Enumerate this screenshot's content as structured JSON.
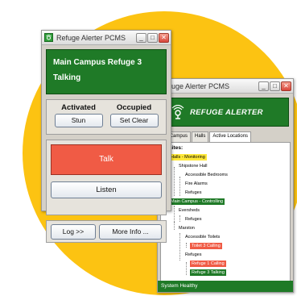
{
  "main_window": {
    "title": "Refuge Alerter PCMS",
    "status": {
      "line1": "Main Campus Refuge 3",
      "line2": "Talking"
    },
    "state": {
      "activated_label": "Activated",
      "stun_button": "Stun",
      "occupied_label": "Occupied",
      "set_clear_button": "Set Clear"
    },
    "talk_button": "Talk",
    "listen_button": "Listen",
    "log_button": "Log >>",
    "more_info_button": "More Info ..."
  },
  "alert_window": {
    "title": "Refuge Alerter PCMS",
    "banner_title": "REFUGE ALERTER",
    "tabs": [
      "ain Campus",
      "Halls",
      "Active Locations"
    ],
    "tree_header": "ll Sites:",
    "tree": [
      {
        "label": "Halls - Monitoring",
        "status": "monitoring"
      },
      {
        "label": "Shipstone Hall",
        "status": ""
      },
      {
        "label": "Accessible Bedrooms",
        "status": ""
      },
      {
        "label": "Fire Alarms",
        "status": ""
      },
      {
        "label": "Refuges",
        "status": ""
      },
      {
        "label": "Main Campus - Controlling",
        "status": "controlling"
      },
      {
        "label": "Eversheds",
        "status": ""
      },
      {
        "label": "Refuges",
        "status": ""
      },
      {
        "label": "Marston",
        "status": ""
      },
      {
        "label": "Accessible Toilets",
        "status": ""
      },
      {
        "label": "Toilet 3 Calling",
        "status": "calling"
      },
      {
        "label": "Refuges",
        "status": ""
      },
      {
        "label": "Refuge 1 Calling",
        "status": "calling"
      },
      {
        "label": "Refuge 3 Talking",
        "status": "talking"
      }
    ],
    "status_bar": "System Healthy"
  },
  "colors": {
    "circle": "#fcc312",
    "green": "#1f7a27",
    "talk_red": "#f05b45",
    "monitoring_yellow": "#ffe83a"
  }
}
